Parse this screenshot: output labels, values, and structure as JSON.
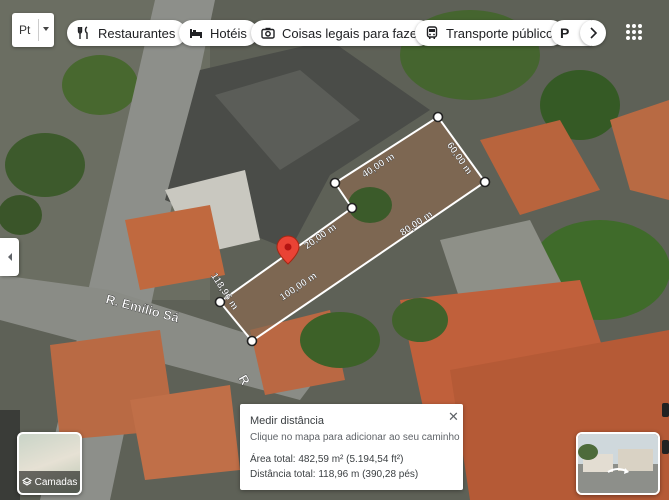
{
  "language": {
    "code": "Pt"
  },
  "chips": [
    {
      "label": "Restaurantes",
      "icon": "fork-knife-icon"
    },
    {
      "label": "Hotéis",
      "icon": "bed-icon"
    },
    {
      "label": "Coisas legais para fazer",
      "icon": "camera-icon"
    },
    {
      "label": "Transporte público",
      "icon": "bus-icon"
    },
    {
      "label": "P",
      "icon": "parking-icon"
    }
  ],
  "measure": {
    "edge_labels": [
      "40,00 m",
      "60,00 m",
      "80,00 m",
      "20,00 m",
      "100,00 m",
      "118,96 m"
    ]
  },
  "streets": [
    "R. Emílio Sá",
    "R"
  ],
  "layers": {
    "label": "Camadas"
  },
  "popup": {
    "title": "Medir distância",
    "hint": "Clique no mapa para adicionar ao seu caminho",
    "area": "Área total: 482,59 m² (5.194,54 ft²)",
    "distance": "Distância total: 118,96 m (390,28 pés)"
  },
  "colors": {
    "measure_line": "#ffffff",
    "pin": "#ea4335",
    "roof": "#c0603b",
    "vegetation": "#3f6b2a"
  }
}
